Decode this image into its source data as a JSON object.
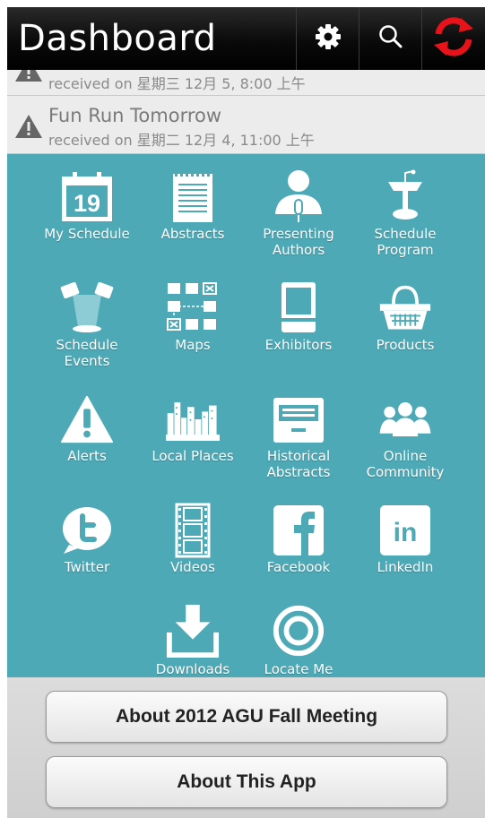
{
  "header": {
    "title": "Dashboard",
    "icons": [
      "gear-icon",
      "search-icon",
      "refresh-icon"
    ],
    "refresh_color": "#e8121a"
  },
  "notifications": [
    {
      "title": "",
      "received": "received on 星期三 12月 5, 8:00 上午"
    },
    {
      "title": "Fun Run Tomorrow",
      "received": "received on 星期二 12月 4, 11:00 上午"
    }
  ],
  "grid": {
    "background": "#4ea9b6",
    "items": [
      {
        "label": "My Schedule",
        "icon": "calendar-icon",
        "calendar_day": "19"
      },
      {
        "label": "Abstracts",
        "icon": "document-icon"
      },
      {
        "label": "Presenting\nAuthors",
        "icon": "presenter-icon"
      },
      {
        "label": "Schedule\nProgram",
        "icon": "podium-icon"
      },
      {
        "label": "Schedule\nEvents",
        "icon": "spotlight-icon"
      },
      {
        "label": "Maps",
        "icon": "map-grid-icon"
      },
      {
        "label": "Exhibitors",
        "icon": "booth-icon"
      },
      {
        "label": "Products",
        "icon": "basket-icon"
      },
      {
        "label": "Alerts",
        "icon": "alert-icon"
      },
      {
        "label": "Local Places",
        "icon": "city-icon"
      },
      {
        "label": "Historical\nAbstracts",
        "icon": "archive-icon"
      },
      {
        "label": "Online\nCommunity",
        "icon": "people-icon"
      },
      {
        "label": "Twitter",
        "icon": "twitter-icon"
      },
      {
        "label": "Videos",
        "icon": "film-icon"
      },
      {
        "label": "Facebook",
        "icon": "facebook-icon"
      },
      {
        "label": "LinkedIn",
        "icon": "linkedin-icon"
      },
      {
        "label": "Downloads",
        "icon": "download-icon"
      },
      {
        "label": "Locate Me",
        "icon": "target-icon"
      }
    ]
  },
  "buttons": {
    "about_meeting": "About 2012 AGU Fall Meeting",
    "about_app": "About This App"
  }
}
